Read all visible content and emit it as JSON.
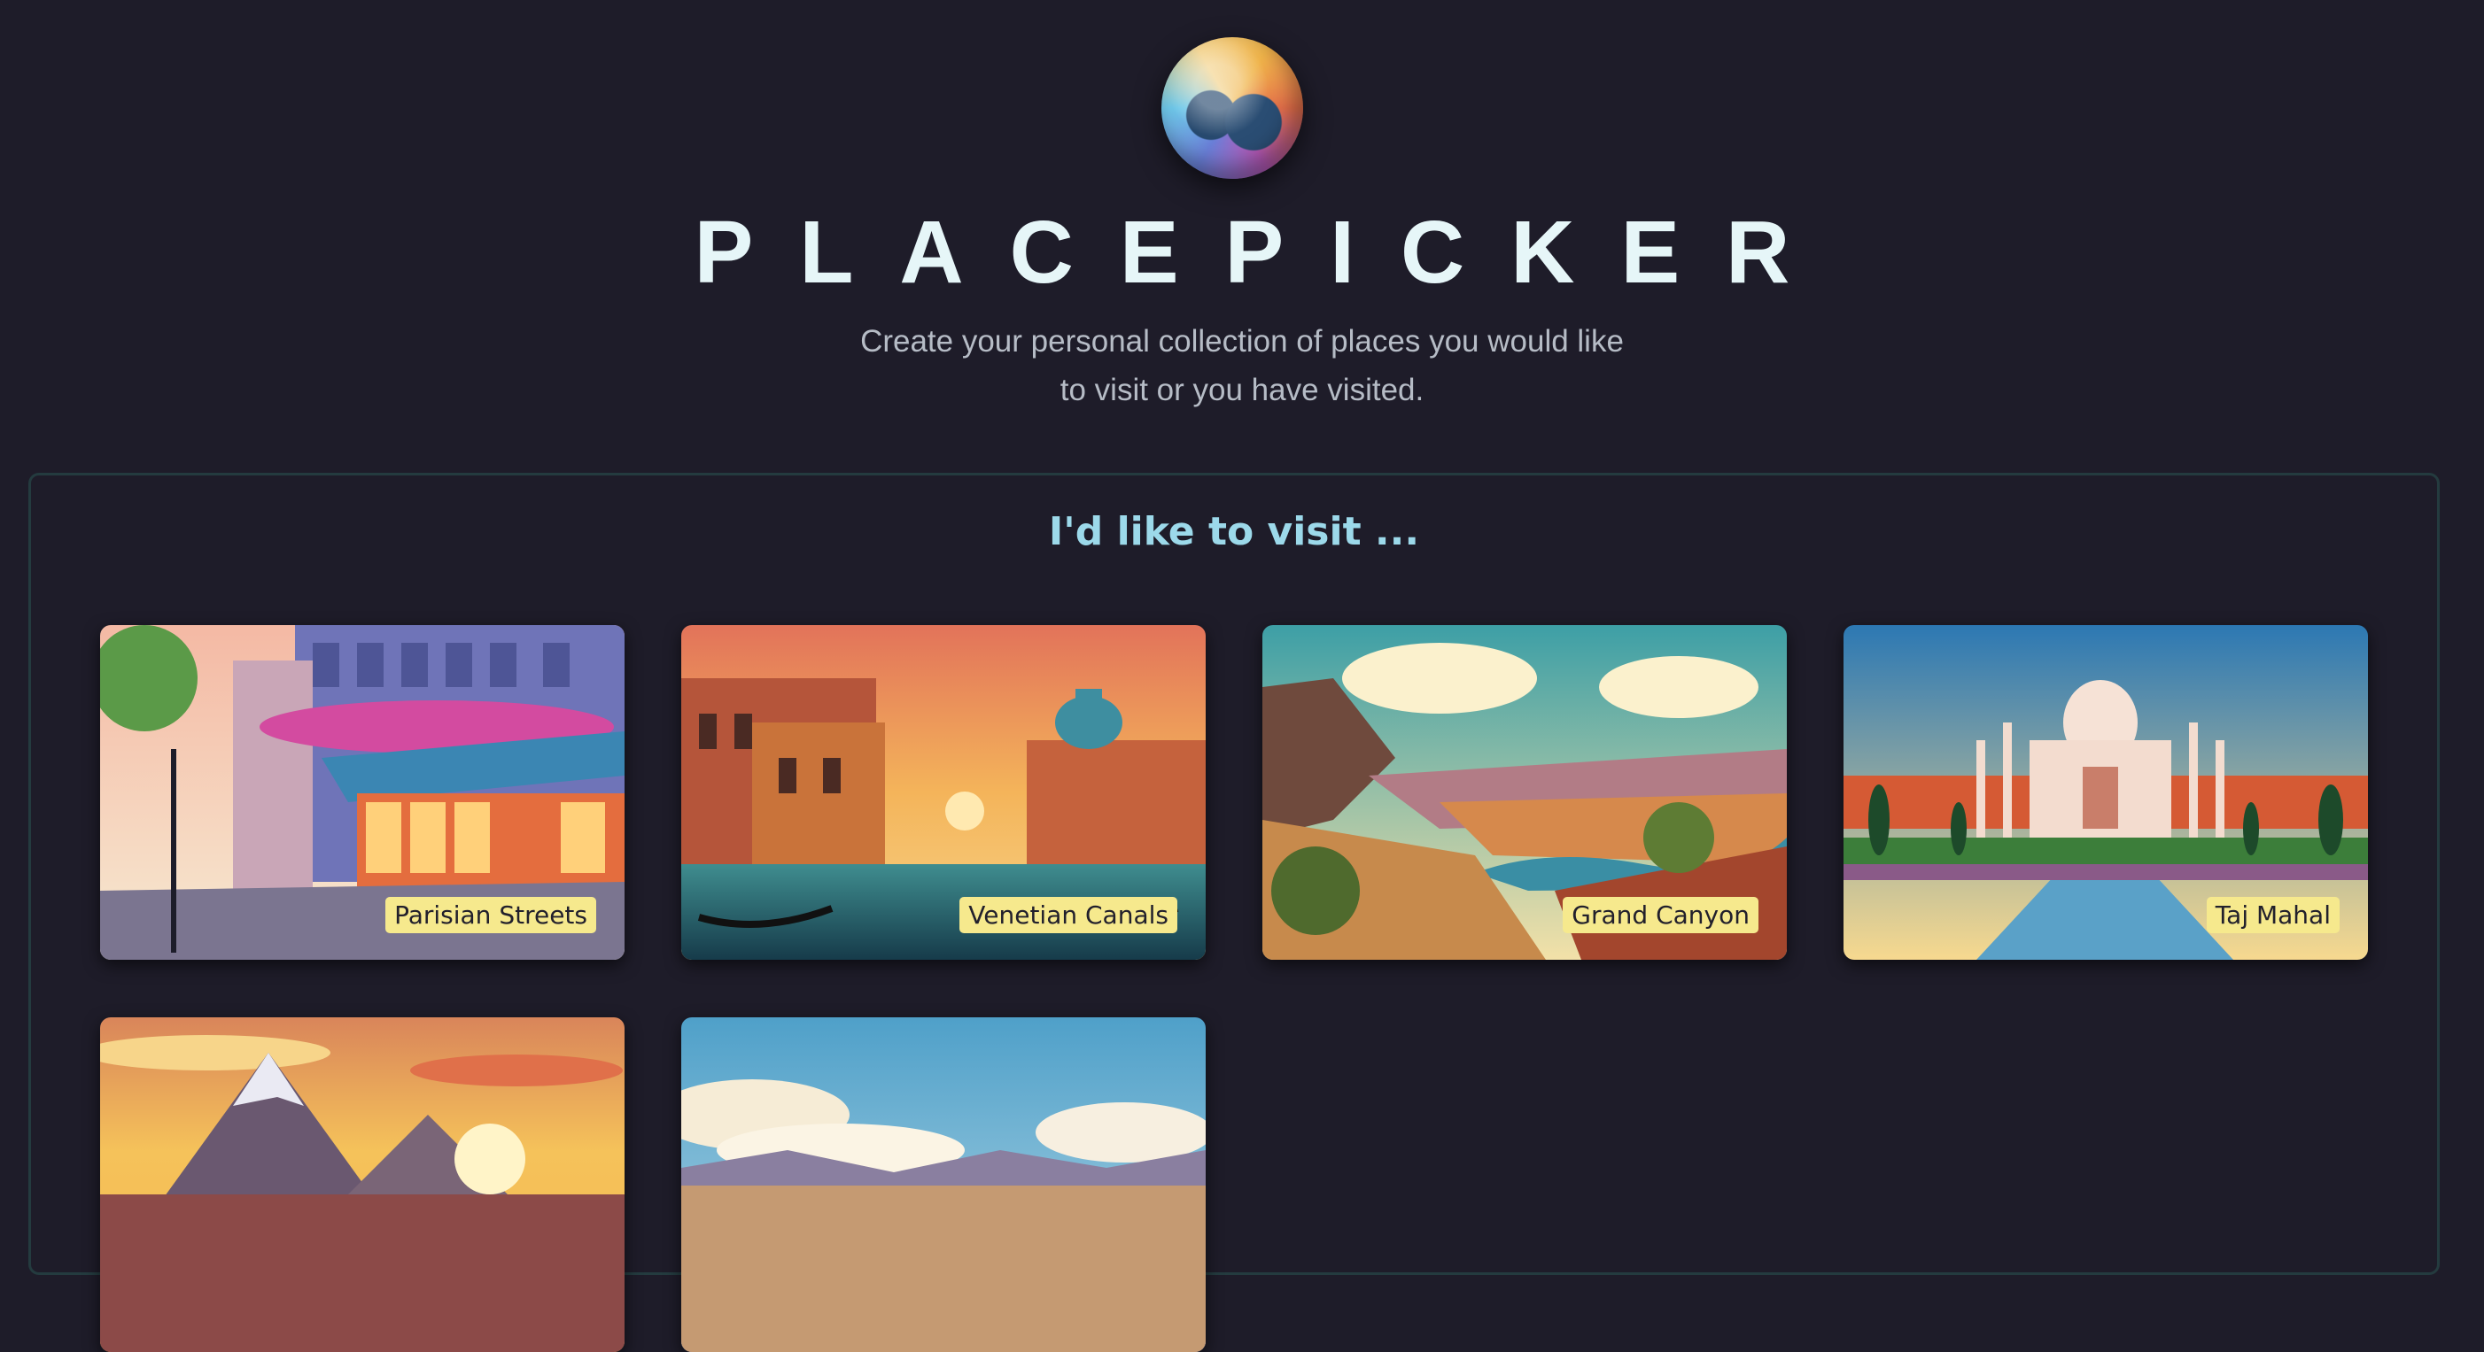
{
  "app": {
    "title": "PLACEPICKER",
    "subtitle": "Create your personal collection of places you would like to visit or you have visited."
  },
  "section": {
    "title": "I'd like to visit ..."
  },
  "places": [
    {
      "label": "Parisian Streets"
    },
    {
      "label": "Venetian Canals"
    },
    {
      "label": "Grand Canyon"
    },
    {
      "label": "Taj Mahal"
    },
    {
      "label": ""
    },
    {
      "label": ""
    }
  ],
  "colors": {
    "background": "#1e1c29",
    "title": "#e6f6f8",
    "section_title": "#9cd9ea",
    "label_bg": "#f6e98d"
  },
  "icons": {
    "logo": "globe-logo"
  }
}
